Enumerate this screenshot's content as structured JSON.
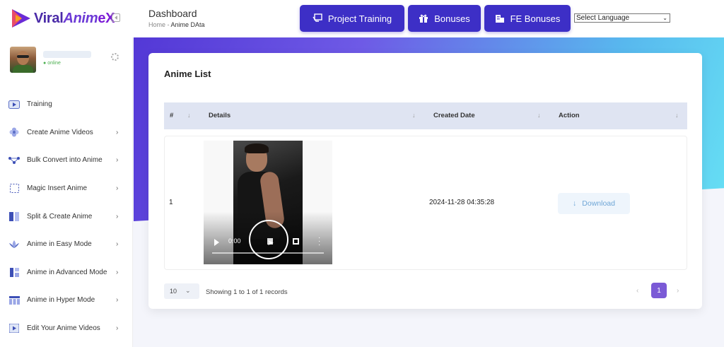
{
  "brand": {
    "part1": "Viral",
    "part2": "Anim",
    "part3": "eX"
  },
  "header": {
    "title": "Dashboard",
    "breadcrumb": {
      "home": "Home",
      "separator": "-",
      "current": "Anime DAta"
    },
    "buttons": [
      {
        "label": "Project Training",
        "icon": "projector-icon"
      },
      {
        "label": "Bonuses",
        "icon": "gift-icon"
      },
      {
        "label": "FE Bonuses",
        "icon": "building-icon"
      }
    ],
    "language_select": {
      "value": "Select Language"
    }
  },
  "user": {
    "status": "online"
  },
  "sidebar": {
    "items": [
      {
        "label": "Training",
        "icon": "video-icon",
        "has_arrow": false
      },
      {
        "label": "Create Anime Videos",
        "icon": "flower-icon",
        "has_arrow": true
      },
      {
        "label": "Bulk Convert into Anime",
        "icon": "nodes-icon",
        "has_arrow": true
      },
      {
        "label": "Magic Insert Anime",
        "icon": "dotted-square-icon",
        "has_arrow": true
      },
      {
        "label": "Split & Create Anime",
        "icon": "split-icon",
        "has_arrow": true
      },
      {
        "label": "Anime in Easy Mode",
        "icon": "lotus-icon",
        "has_arrow": true
      },
      {
        "label": "Anime in Advanced Mode",
        "icon": "layout-icon",
        "has_arrow": true
      },
      {
        "label": "Anime in Hyper Mode",
        "icon": "grid-icon",
        "has_arrow": true
      },
      {
        "label": "Edit Your Anime Videos",
        "icon": "edit-video-icon",
        "has_arrow": true
      }
    ]
  },
  "card": {
    "title": "Anime List",
    "columns": [
      "#",
      "Details",
      "Created Date",
      "Action"
    ],
    "rows": [
      {
        "index": "1",
        "video_time": "0:00",
        "created": "2024-11-28 04:35:28",
        "action": "Download"
      }
    ],
    "per_page": "10",
    "showing": "Showing 1 to 1 of 1 records",
    "current_page": "1"
  },
  "colors": {
    "primary": "#3d2fc6",
    "accent": "#7b5ad6",
    "download_text": "#6fa6d6",
    "online": "#4caf50"
  }
}
